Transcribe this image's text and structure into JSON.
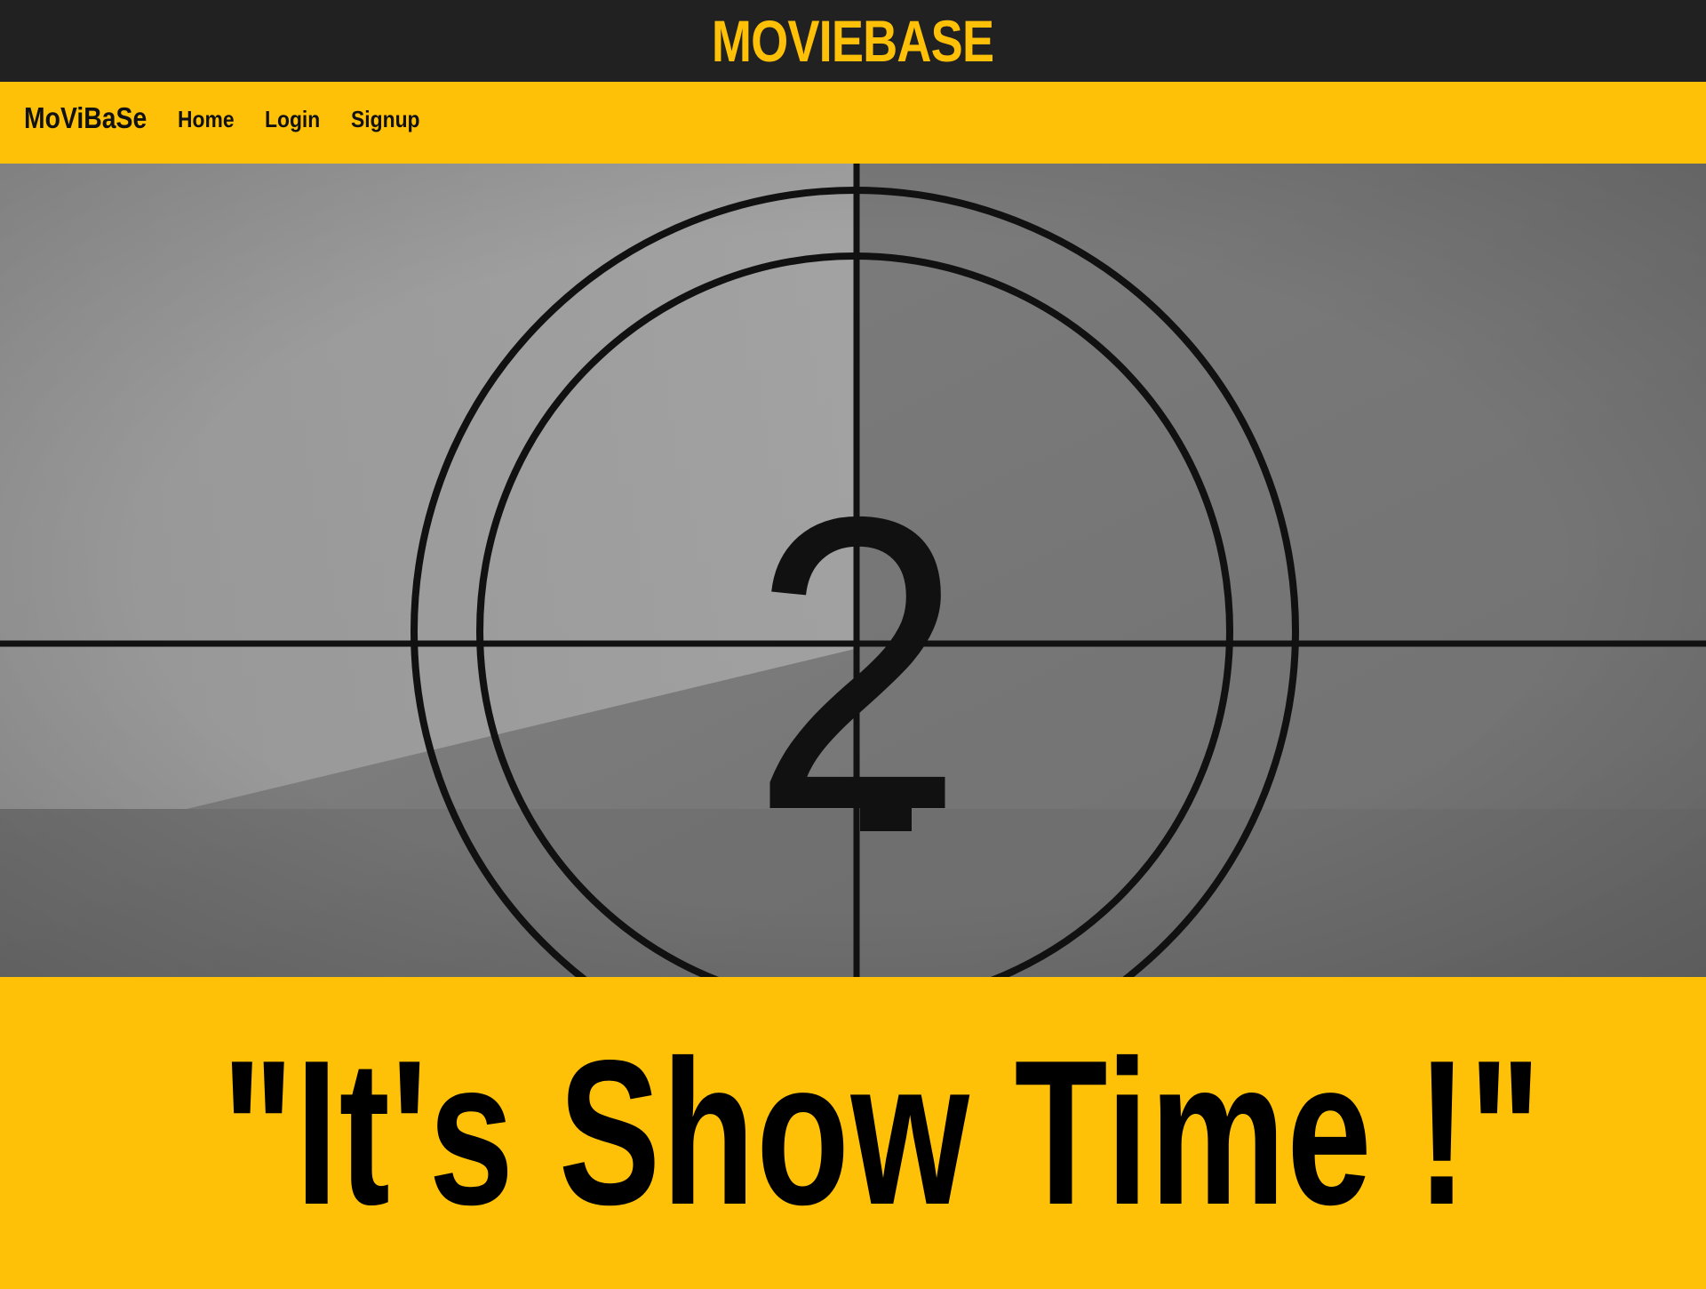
{
  "header": {
    "title": "MOVIEBASE"
  },
  "navbar": {
    "brand": "MoViBaSe",
    "links": [
      {
        "label": "Home"
      },
      {
        "label": "Login"
      },
      {
        "label": "Signup"
      }
    ]
  },
  "hero": {
    "countdown_number": "2",
    "image_desc_icon": "film-countdown-leader"
  },
  "banner": {
    "slogan": "\"It's Show Time !\""
  },
  "colors": {
    "accent": "#ffc107",
    "topbar": "#212121",
    "text": "#000000"
  }
}
